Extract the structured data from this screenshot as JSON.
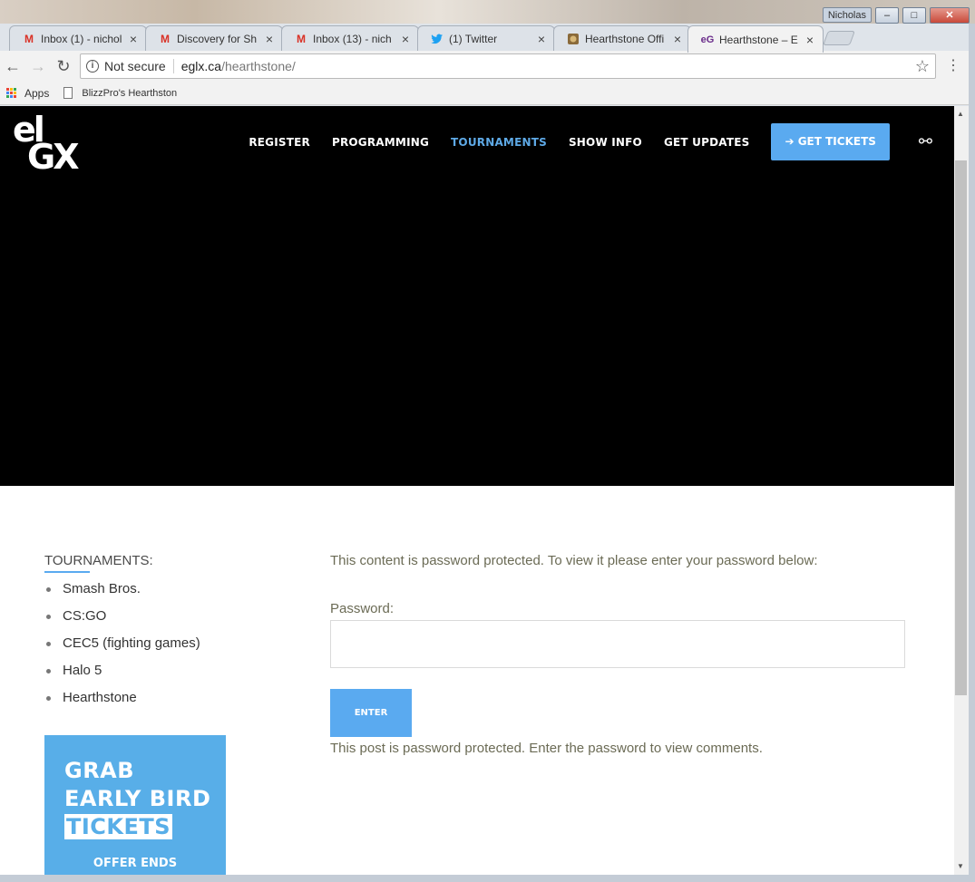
{
  "window": {
    "user": "Nicholas",
    "controls": [
      "–",
      "□",
      "✕"
    ]
  },
  "tabs": [
    {
      "label": "Inbox (1) - nichol",
      "icon": "gmail-icon",
      "active": false
    },
    {
      "label": "Discovery for Sh",
      "icon": "gmail-icon",
      "active": false
    },
    {
      "label": "Inbox (13) - nich",
      "icon": "gmail-icon",
      "active": false
    },
    {
      "label": "(1) Twitter",
      "icon": "twitter-icon",
      "active": false
    },
    {
      "label": "Hearthstone Offi",
      "icon": "hearthstone-icon",
      "active": false
    },
    {
      "label": "Hearthstone – E",
      "icon": "eglx-icon",
      "active": true
    }
  ],
  "toolbar": {
    "security_label": "Not secure",
    "url_host": "eglx.ca",
    "url_path": "/hearthstone/"
  },
  "bookmarks": {
    "apps_label": "Apps",
    "items": [
      "BlizzPro's Hearthston"
    ]
  },
  "site": {
    "logo_top": "el",
    "logo_bottom": "GX",
    "nav": [
      "REGISTER",
      "PROGRAMMING",
      "TOURNAMENTS",
      "SHOW INFO",
      "GET UPDATES"
    ],
    "active_nav": "TOURNAMENTS",
    "tickets_label": "GET TICKETS",
    "accent": "#5aaaf0"
  },
  "sidebar": {
    "title": "TOURNAMENTS:",
    "items": [
      "Smash Bros.",
      "CS:GO",
      "CEC5 (fighting games)",
      "Halo 5",
      "Hearthstone"
    ]
  },
  "promo": {
    "line1": "GRAB",
    "line2": "EARLY BIRD",
    "line3": "TICKETS",
    "line4": "OFFER ENDS"
  },
  "main": {
    "intro": "This content is password protected. To view it please enter your password below:",
    "password_label": "Password:",
    "password_value": "",
    "enter_label": "ENTER",
    "note": "This post is password protected. Enter the password to view comments."
  }
}
